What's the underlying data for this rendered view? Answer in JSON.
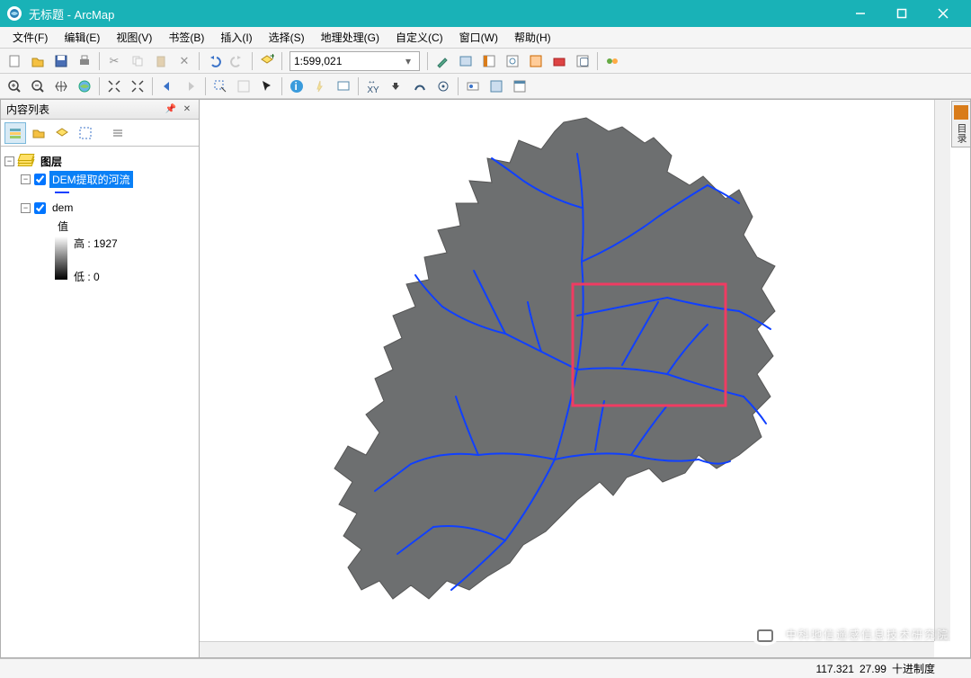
{
  "title": "无标题 - ArcMap",
  "menus": [
    "文件(F)",
    "编辑(E)",
    "视图(V)",
    "书签(B)",
    "插入(I)",
    "选择(S)",
    "地理处理(G)",
    "自定义(C)",
    "窗口(W)",
    "帮助(H)"
  ],
  "scale": "1:599,021",
  "toc": {
    "title": "内容列表",
    "root": "图层",
    "layer_river": "DEM提取的河流",
    "layer_dem": "dem",
    "value_label": "值",
    "high_label": "高 : 1927",
    "low_label": "低 : 0"
  },
  "status": {
    "x": "117.321",
    "y": "27.99",
    "unit": "十进制度"
  },
  "side_dock": "目录",
  "watermark": "中科地信遥感信息技术研究院",
  "colors": {
    "accent": "#19b2b7",
    "river": "#1040ff",
    "sel": "#0a80f6",
    "highlight_box": "#ef3b62"
  }
}
